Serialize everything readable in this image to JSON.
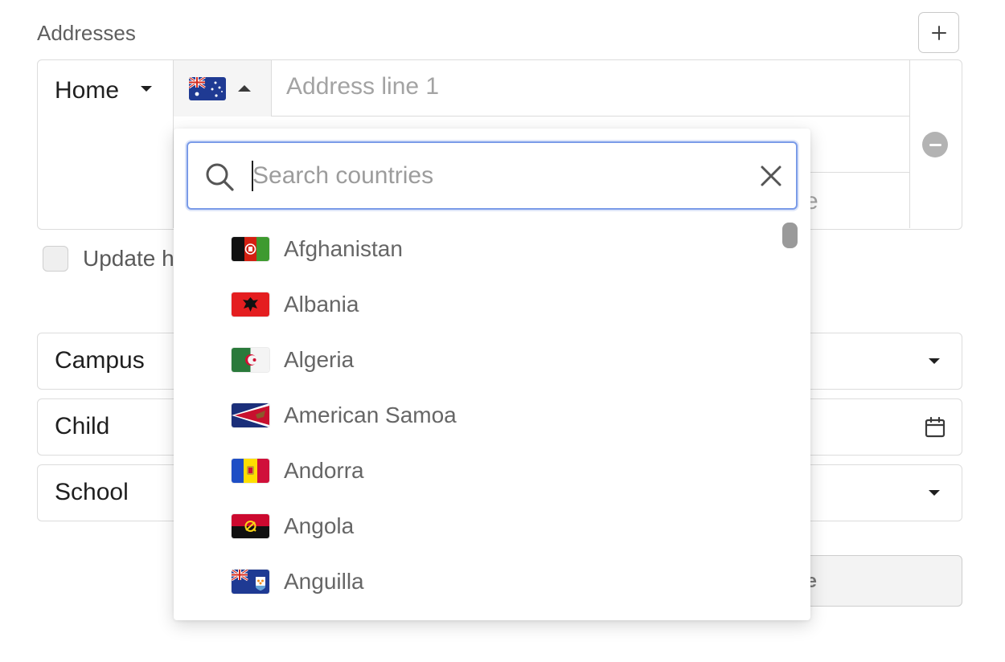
{
  "addresses": {
    "title": "Addresses",
    "add_icon": "plus-icon",
    "card": {
      "type_label": "Home",
      "address_line1_placeholder": "Address line 1",
      "line3_tail_visible": "e",
      "remove_icon": "minus-circle-icon"
    },
    "checkbox_label_visible": "Update h"
  },
  "fields": {
    "campus": "Campus",
    "child": "Child",
    "school": "School"
  },
  "note_button_visible": "ote",
  "country_dropdown": {
    "search_placeholder": "Search countries",
    "countries": [
      {
        "name": "Afghanistan"
      },
      {
        "name": "Albania"
      },
      {
        "name": "Algeria"
      },
      {
        "name": "American Samoa"
      },
      {
        "name": "Andorra"
      },
      {
        "name": "Angola"
      },
      {
        "name": "Anguilla"
      }
    ]
  },
  "colors": {
    "focus_border": "#7a9be8",
    "border": "#dcdcdc",
    "placeholder": "#a3a3a3"
  }
}
